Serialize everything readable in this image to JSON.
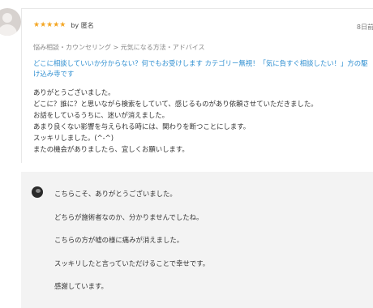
{
  "review": {
    "stars": "★★★★★",
    "by_label": "by 匿名",
    "date": "8日前",
    "breadcrumb": "悩み相談・カウンセリング > 元気になる方法・アドバイス",
    "service_title": "どこに相談していいか分からない？何でもお受けします カテゴリー無視！「気に負すぐ相談したい！」方の駆け込み寺です",
    "lines": [
      "ありがとうございました。",
      "どこに？誰に？と思いながら検索をしていて、感じるものがあり依頼させていただきました。",
      "お話をしているうちに、迷いが消えました。",
      "あまり良くない影響を与えられる時には、関わりを断つことにします。",
      "スッキリしました。(^-^)",
      "またの機会がありましたら、宜しくお願いします。"
    ]
  },
  "reply": {
    "lines": [
      "こちらこそ、ありがとうございました。",
      "どちらが施術者なのか、分かりませんでしたね。",
      "こちらの方が嘘の様に痛みが消えました。",
      "スッキリしたと言っていただけることで幸せです。",
      "感謝しています。"
    ]
  },
  "icons": {
    "reviewer_avatar": "user-avatar-icon",
    "seller_avatar": "seller-avatar-icon",
    "rating": "star-icon"
  },
  "colors": {
    "star": "#f4a623",
    "link": "#2f8fd1",
    "reply_background": "#f3f3f3"
  }
}
